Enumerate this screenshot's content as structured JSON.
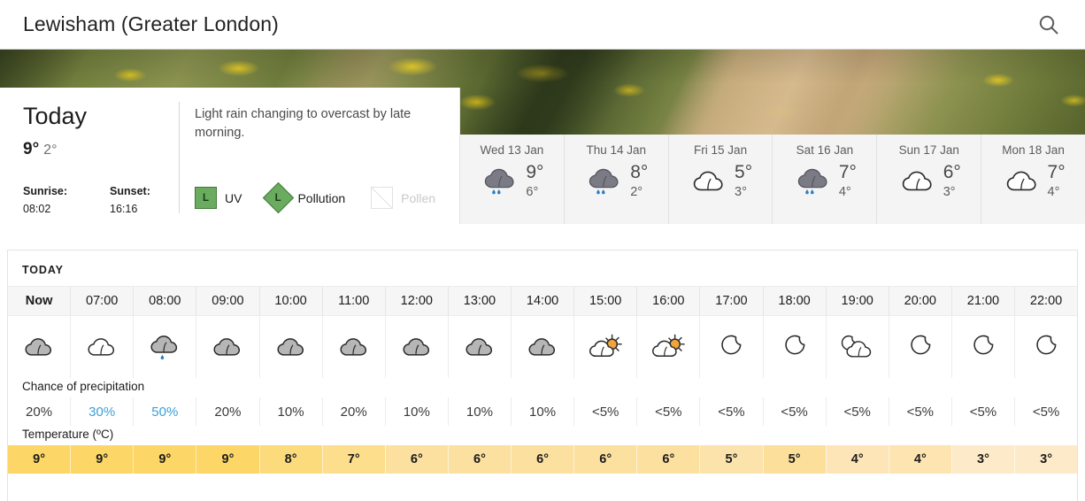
{
  "search": {
    "location": "Lewisham (Greater London)",
    "icon": "search-icon"
  },
  "today": {
    "title": "Today",
    "high": "9°",
    "low": "2°",
    "summary": "Light rain changing to overcast by late morning.",
    "sunrise_label": "Sunrise:",
    "sunrise_value": "08:02",
    "sunset_label": "Sunset:",
    "sunset_value": "16:16",
    "badges": [
      {
        "label": "UV",
        "value": "L",
        "shape": "square",
        "state": "active"
      },
      {
        "label": "Pollution",
        "value": "L",
        "shape": "diamond",
        "state": "active"
      },
      {
        "label": "Pollen",
        "value": "",
        "shape": "empty",
        "state": "disabled"
      }
    ]
  },
  "daily": [
    {
      "name": "Wed 13 Jan",
      "high": "9°",
      "low": "6°",
      "icon": "rain-cloud-icon"
    },
    {
      "name": "Thu 14 Jan",
      "high": "8°",
      "low": "2°",
      "icon": "rain-cloud-icon"
    },
    {
      "name": "Fri 15 Jan",
      "high": "5°",
      "low": "3°",
      "icon": "white-cloud-icon"
    },
    {
      "name": "Sat 16 Jan",
      "high": "7°",
      "low": "4°",
      "icon": "rain-cloud-icon"
    },
    {
      "name": "Sun 17 Jan",
      "high": "6°",
      "low": "3°",
      "icon": "white-cloud-icon"
    },
    {
      "name": "Mon 18 Jan",
      "high": "7°",
      "low": "4°",
      "icon": "white-cloud-icon"
    }
  ],
  "hourly": {
    "heading": "TODAY",
    "precip_label": "Chance of precipitation",
    "temp_label": "Temperature (ºC)",
    "hours": [
      {
        "time": "Now",
        "icon": "grey-cloud-icon",
        "precip": "20%",
        "precip_highlight": false,
        "temp": "9°",
        "temp_color": "#fcd667"
      },
      {
        "time": "07:00",
        "icon": "white-cloud-icon",
        "precip": "30%",
        "precip_highlight": true,
        "temp": "9°",
        "temp_color": "#fcd667"
      },
      {
        "time": "08:00",
        "icon": "grey-cloud-drizzle-icon",
        "precip": "50%",
        "precip_highlight": true,
        "temp": "9°",
        "temp_color": "#fcd667"
      },
      {
        "time": "09:00",
        "icon": "grey-cloud-icon",
        "precip": "20%",
        "precip_highlight": false,
        "temp": "9°",
        "temp_color": "#fcd667"
      },
      {
        "time": "10:00",
        "icon": "grey-cloud-icon",
        "precip": "10%",
        "precip_highlight": false,
        "temp": "8°",
        "temp_color": "#fcdb7c"
      },
      {
        "time": "11:00",
        "icon": "grey-cloud-icon",
        "precip": "20%",
        "precip_highlight": false,
        "temp": "7°",
        "temp_color": "#fcde8c"
      },
      {
        "time": "12:00",
        "icon": "grey-cloud-icon",
        "precip": "10%",
        "precip_highlight": false,
        "temp": "6°",
        "temp_color": "#fce0a0"
      },
      {
        "time": "13:00",
        "icon": "grey-cloud-icon",
        "precip": "10%",
        "precip_highlight": false,
        "temp": "6°",
        "temp_color": "#fce0a0"
      },
      {
        "time": "14:00",
        "icon": "grey-cloud-icon",
        "precip": "10%",
        "precip_highlight": false,
        "temp": "6°",
        "temp_color": "#fce0a0"
      },
      {
        "time": "15:00",
        "icon": "sun-cloud-icon",
        "precip": "<5%",
        "precip_highlight": false,
        "temp": "6°",
        "temp_color": "#fce0a0"
      },
      {
        "time": "16:00",
        "icon": "sun-cloud-icon",
        "precip": "<5%",
        "precip_highlight": false,
        "temp": "6°",
        "temp_color": "#fce0a0"
      },
      {
        "time": "17:00",
        "icon": "moon-icon",
        "precip": "<5%",
        "precip_highlight": false,
        "temp": "5°",
        "temp_color": "#fce2ab"
      },
      {
        "time": "18:00",
        "icon": "moon-icon",
        "precip": "<5%",
        "precip_highlight": false,
        "temp": "5°",
        "temp_color": "#fcdf9a"
      },
      {
        "time": "19:00",
        "icon": "moon-cloud-icon",
        "precip": "<5%",
        "precip_highlight": false,
        "temp": "4°",
        "temp_color": "#fde5b8"
      },
      {
        "time": "20:00",
        "icon": "moon-icon",
        "precip": "<5%",
        "precip_highlight": false,
        "temp": "4°",
        "temp_color": "#fde4b0"
      },
      {
        "time": "21:00",
        "icon": "moon-icon",
        "precip": "<5%",
        "precip_highlight": false,
        "temp": "3°",
        "temp_color": "#fdeac8"
      },
      {
        "time": "22:00",
        "icon": "moon-icon",
        "precip": "<5%",
        "precip_highlight": false,
        "temp": "3°",
        "temp_color": "#fdeac8"
      }
    ]
  },
  "colors": {
    "accent_blue": "#3ba0d8",
    "badge_green": "#6aab5f",
    "rain_blue": "#2b7fc4",
    "sun_orange": "#f2a33c",
    "cloud_grey": "#b6b6b6"
  }
}
